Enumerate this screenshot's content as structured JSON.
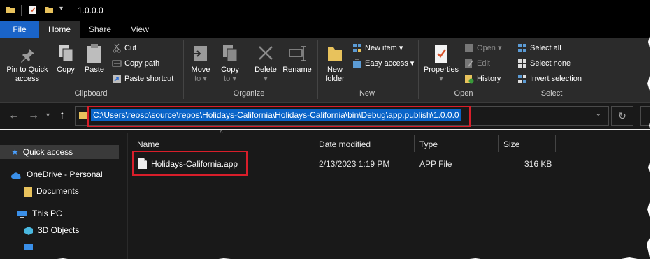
{
  "window": {
    "title": "1.0.0.0"
  },
  "ribbon_tabs": [
    "File",
    "Home",
    "Share",
    "View"
  ],
  "clipboard": {
    "pin_label_1": "Pin to Quick",
    "pin_label_2": "access",
    "copy": "Copy",
    "paste": "Paste",
    "cut": "Cut",
    "copy_path": "Copy path",
    "paste_shortcut": "Paste shortcut",
    "group": "Clipboard"
  },
  "organize": {
    "move_1": "Move",
    "move_2": "to",
    "copy_1": "Copy",
    "copy_2": "to",
    "delete": "Delete",
    "rename": "Rename",
    "group": "Organize"
  },
  "new": {
    "folder_1": "New",
    "folder_2": "folder",
    "new_item": "New item",
    "easy_access": "Easy access",
    "group": "New"
  },
  "open": {
    "properties": "Properties",
    "open": "Open",
    "edit": "Edit",
    "history": "History",
    "group": "Open"
  },
  "select": {
    "select_all": "Select all",
    "select_none": "Select none",
    "invert": "Invert selection",
    "group": "Select"
  },
  "address": {
    "path": "C:\\Users\\reoso\\source\\repos\\Holidays-California\\Holidays-California\\bin\\Debug\\app.publish\\1.0.0.0"
  },
  "nav_pane": {
    "quick_access": "Quick access",
    "onedrive": "OneDrive - Personal",
    "documents": "Documents",
    "this_pc": "This PC",
    "objects3d": "3D Objects"
  },
  "columns": {
    "name": "Name",
    "date": "Date modified",
    "type": "Type",
    "size": "Size"
  },
  "files": [
    {
      "name": "Holidays-California.app",
      "date": "2/13/2023 1:19 PM",
      "type": "APP File",
      "size": "316 KB"
    }
  ],
  "colors": {
    "accent": "#1a64c8",
    "highlight": "#d81e2a",
    "background": "#191919"
  }
}
